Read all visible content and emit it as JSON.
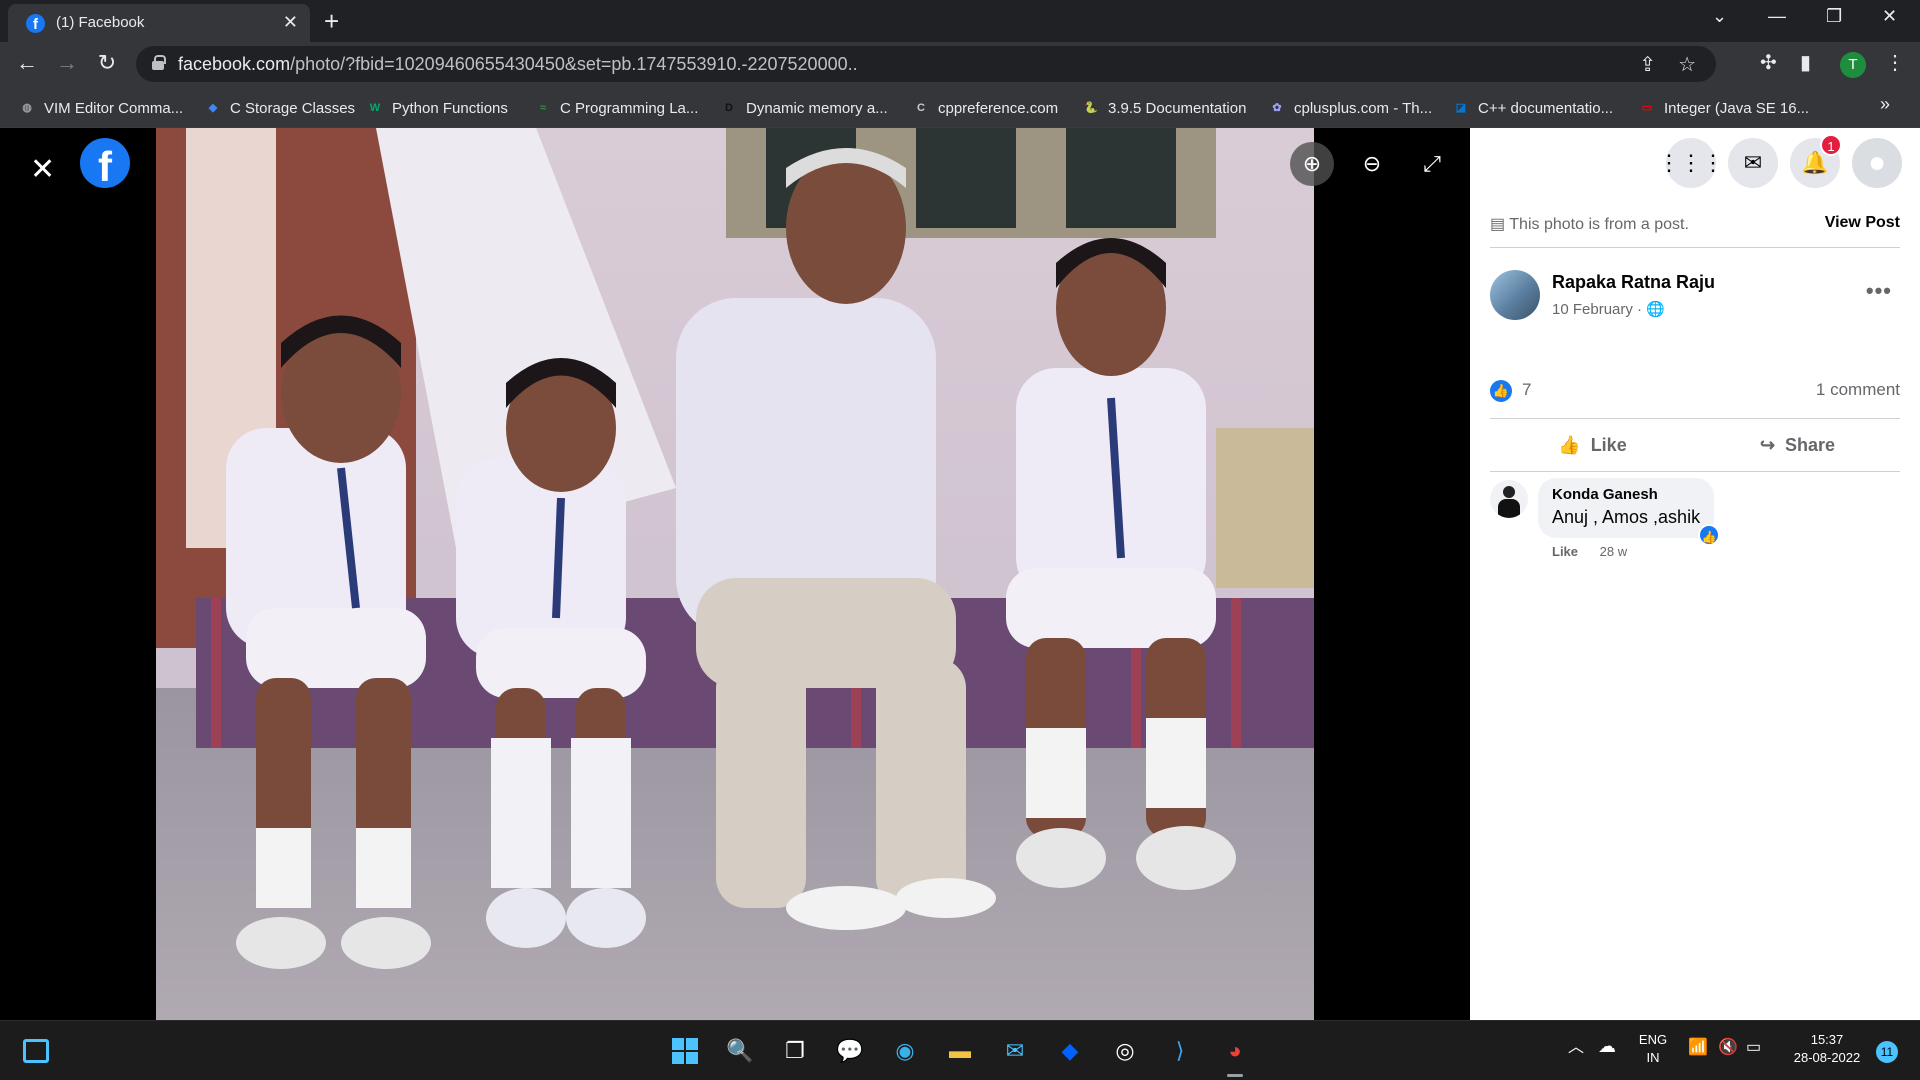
{
  "browser": {
    "tab_title": "(1) Facebook",
    "tab_close": "✕",
    "new_tab": "+",
    "url_domain": "facebook.com",
    "url_path": "/photo/?fbid=10209460655430450&set=pb.1747553910.-2207520000..",
    "profile_initial": "T"
  },
  "bookmarks": [
    {
      "label": "VIM Editor Comma...",
      "icon": "globe-icon",
      "color": "#9aa0a6"
    },
    {
      "label": "C Storage Classes",
      "icon": "bookmark-diamond-icon",
      "color": "#4285f4"
    },
    {
      "label": "Python Functions",
      "icon": "w3schools-icon",
      "color": "#04aa6d"
    },
    {
      "label": "C Programming La...",
      "icon": "geeks-icon",
      "color": "#2f8d46"
    },
    {
      "label": "Dynamic memory a...",
      "icon": "d-icon",
      "color": "#111111"
    },
    {
      "label": "cppreference.com",
      "icon": "cppref-icon",
      "color": "#cccccc"
    },
    {
      "label": "3.9.5 Documentation",
      "icon": "python-icon",
      "color": "#3776ab"
    },
    {
      "label": "cplusplus.com - Th...",
      "icon": "cplusplus-icon",
      "color": "#a0a0ff"
    },
    {
      "label": "C++ documentatio...",
      "icon": "msdocs-icon",
      "color": "#0078d4"
    },
    {
      "label": "Integer (Java SE 16...",
      "icon": "oracle-icon",
      "color": "#e30613"
    }
  ],
  "viewer": {
    "close": "✕",
    "logo": "f",
    "zoom_in": "⊕",
    "zoom_out": "⊖",
    "fullscreen": "⤢"
  },
  "panel": {
    "notifications_badge": "1",
    "post_note": "This photo is from a post.",
    "view_post": "View Post",
    "author_name": "Rapaka Ratna Raju",
    "post_date": "10 February ·",
    "like_count": "7",
    "comment_count": "1 comment",
    "like_label": "Like",
    "share_label": "Share",
    "comment": {
      "author": "Konda Ganesh",
      "text": "Anuj , Amos ,ashik",
      "like_action": "Like",
      "age": "28 w"
    }
  },
  "taskbar": {
    "lang_top": "ENG",
    "lang_bottom": "IN",
    "time": "15:37",
    "date": "28-08-2022",
    "notifications": "11"
  },
  "colors": {
    "facebook_blue": "#1877f2",
    "chrome_dark": "#35363a",
    "notification_red": "#e41e3f"
  }
}
